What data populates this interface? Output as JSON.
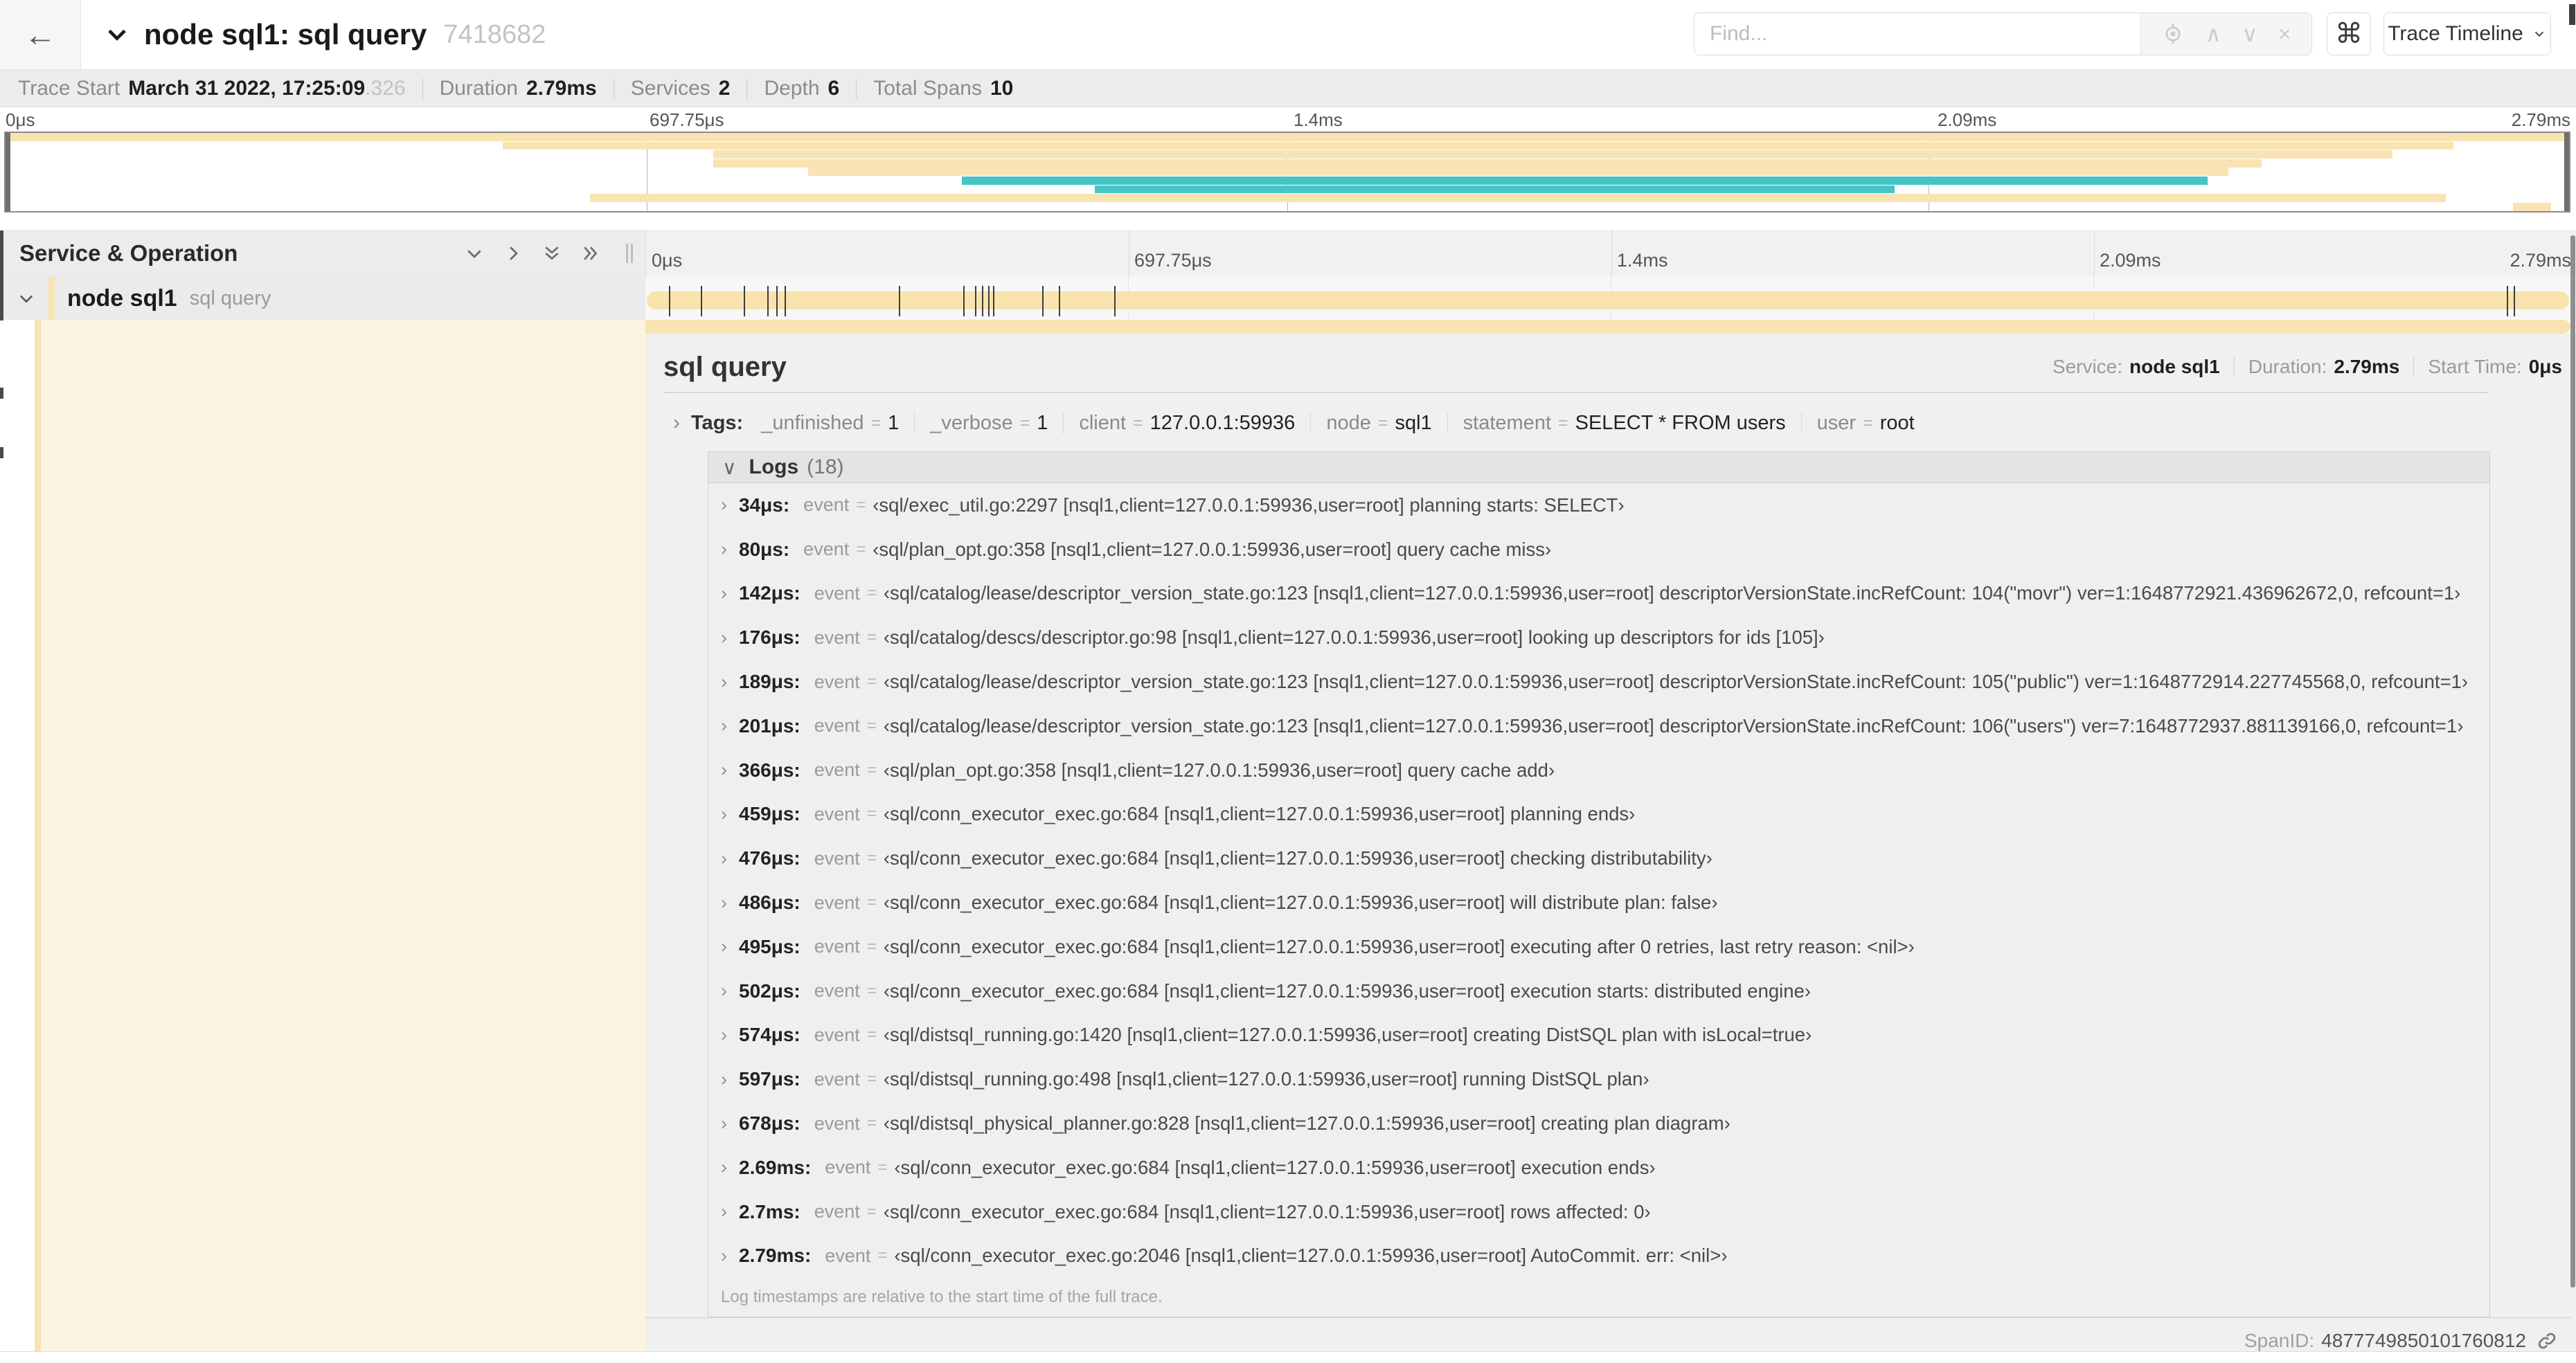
{
  "header": {
    "back_icon": "←",
    "title": "node sql1: sql query",
    "trace_id": "7418682",
    "find_placeholder": "Find...",
    "up_icon": "∧",
    "down_icon": "∨",
    "clear_icon": "×",
    "cmd_icon": "⌘",
    "view_selector_label": "Trace Timeline"
  },
  "trace_info": {
    "trace_start_label": "Trace Start",
    "trace_start_value": "March 31 2022, 17:25:09",
    "trace_start_fraction": ".326",
    "duration_label": "Duration",
    "duration_value": "2.79ms",
    "services_label": "Services",
    "services_value": "2",
    "depth_label": "Depth",
    "depth_value": "6",
    "total_spans_label": "Total Spans",
    "total_spans_value": "10"
  },
  "timeline": {
    "left_header": "Service & Operation",
    "ticks": [
      "0μs",
      "697.75μs",
      "1.4ms",
      "2.09ms",
      "2.79ms"
    ],
    "tick_positions_pct": [
      0,
      25,
      50,
      75,
      100
    ],
    "grid_pct": [
      25,
      50,
      75
    ],
    "row": {
      "service": "node sql1",
      "operation": "sql query"
    },
    "log_marker_pct": [
      1.22,
      2.87,
      5.09,
      6.31,
      6.77,
      7.2,
      13.12,
      16.45,
      17.06,
      17.42,
      17.74,
      17.99,
      20.57,
      21.4,
      24.3,
      96.42,
      96.77,
      99.8
    ]
  },
  "minimap": {
    "spans": [
      {
        "left": 0,
        "width": 100,
        "color": "#f9e3b2"
      },
      {
        "left": 19.4,
        "width": 76.1,
        "color": "#f9e3b2"
      },
      {
        "left": 27.6,
        "width": 65.5,
        "color": "#f9e3b2"
      },
      {
        "left": 27.6,
        "width": 60.4,
        "color": "#f9e3b2"
      },
      {
        "left": 31.3,
        "width": 55.4,
        "color": "#f9e3b2"
      },
      {
        "left": 37.3,
        "width": 48.6,
        "color": "#46c5c9"
      },
      {
        "left": 42.5,
        "width": 31.2,
        "color": "#46c5c9"
      },
      {
        "left": 22.8,
        "width": 72.4,
        "color": "#f9e3b2"
      },
      {
        "left": 97.8,
        "width": 1.5,
        "color": "#f9e3b2"
      }
    ]
  },
  "detail": {
    "title": "sql query",
    "service_label": "Service:",
    "service_value": "node sql1",
    "duration_label": "Duration:",
    "duration_value": "2.79ms",
    "start_time_label": "Start Time:",
    "start_time_value": "0μs",
    "caret": "›",
    "tags_label": "Tags:",
    "tags": [
      {
        "key": "_unfinished",
        "value": "1"
      },
      {
        "key": "_verbose",
        "value": "1"
      },
      {
        "key": "client",
        "value": "127.0.0.1:59936"
      },
      {
        "key": "node",
        "value": "sql1"
      },
      {
        "key": "statement",
        "value": "SELECT * FROM users"
      },
      {
        "key": "user",
        "value": "root"
      }
    ],
    "logs_caret": "∨",
    "logs_label": "Logs",
    "logs_count": "(18)",
    "log_field_label": "event",
    "logs": [
      {
        "time": "34μs:",
        "value": "‹sql/exec_util.go:2297 [nsql1,client=127.0.0.1:59936,user=root] planning starts: SELECT›"
      },
      {
        "time": "80μs:",
        "value": "‹sql/plan_opt.go:358 [nsql1,client=127.0.0.1:59936,user=root] query cache miss›"
      },
      {
        "time": "142μs:",
        "value": "‹sql/catalog/lease/descriptor_version_state.go:123 [nsql1,client=127.0.0.1:59936,user=root] descriptorVersionState.incRefCount: 104(\"movr\") ver=1:1648772921.436962672,0, refcount=1›"
      },
      {
        "time": "176μs:",
        "value": "‹sql/catalog/descs/descriptor.go:98 [nsql1,client=127.0.0.1:59936,user=root] looking up descriptors for ids [105]›"
      },
      {
        "time": "189μs:",
        "value": "‹sql/catalog/lease/descriptor_version_state.go:123 [nsql1,client=127.0.0.1:59936,user=root] descriptorVersionState.incRefCount: 105(\"public\") ver=1:1648772914.227745568,0, refcount=1›"
      },
      {
        "time": "201μs:",
        "value": "‹sql/catalog/lease/descriptor_version_state.go:123 [nsql1,client=127.0.0.1:59936,user=root] descriptorVersionState.incRefCount: 106(\"users\") ver=7:1648772937.881139166,0, refcount=1›"
      },
      {
        "time": "366μs:",
        "value": "‹sql/plan_opt.go:358 [nsql1,client=127.0.0.1:59936,user=root] query cache add›"
      },
      {
        "time": "459μs:",
        "value": "‹sql/conn_executor_exec.go:684 [nsql1,client=127.0.0.1:59936,user=root] planning ends›"
      },
      {
        "time": "476μs:",
        "value": "‹sql/conn_executor_exec.go:684 [nsql1,client=127.0.0.1:59936,user=root] checking distributability›"
      },
      {
        "time": "486μs:",
        "value": "‹sql/conn_executor_exec.go:684 [nsql1,client=127.0.0.1:59936,user=root] will distribute plan: false›"
      },
      {
        "time": "495μs:",
        "value": "‹sql/conn_executor_exec.go:684 [nsql1,client=127.0.0.1:59936,user=root] executing after 0 retries, last retry reason: <nil>›"
      },
      {
        "time": "502μs:",
        "value": "‹sql/conn_executor_exec.go:684 [nsql1,client=127.0.0.1:59936,user=root] execution starts: distributed engine›"
      },
      {
        "time": "574μs:",
        "value": "‹sql/distsql_running.go:1420 [nsql1,client=127.0.0.1:59936,user=root] creating DistSQL plan with isLocal=true›"
      },
      {
        "time": "597μs:",
        "value": "‹sql/distsql_running.go:498 [nsql1,client=127.0.0.1:59936,user=root] running DistSQL plan›"
      },
      {
        "time": "678μs:",
        "value": "‹sql/distsql_physical_planner.go:828 [nsql1,client=127.0.0.1:59936,user=root] creating plan diagram›"
      },
      {
        "time": "2.69ms:",
        "value": "‹sql/conn_executor_exec.go:684 [nsql1,client=127.0.0.1:59936,user=root] execution ends›"
      },
      {
        "time": "2.7ms:",
        "value": "‹sql/conn_executor_exec.go:684 [nsql1,client=127.0.0.1:59936,user=root] rows affected: 0›"
      },
      {
        "time": "2.79ms:",
        "value": "‹sql/conn_executor_exec.go:2046 [nsql1,client=127.0.0.1:59936,user=root] AutoCommit. err: <nil>›"
      }
    ],
    "footer_note": "Log timestamps are relative to the start time of the full trace.",
    "span_id_label": "SpanID:",
    "span_id_value": "4877749850101760812"
  },
  "colors": {
    "span_tan": "#f9e3b2",
    "span_teal": "#46c5c9",
    "bar_tan": "#f8e2ad"
  }
}
